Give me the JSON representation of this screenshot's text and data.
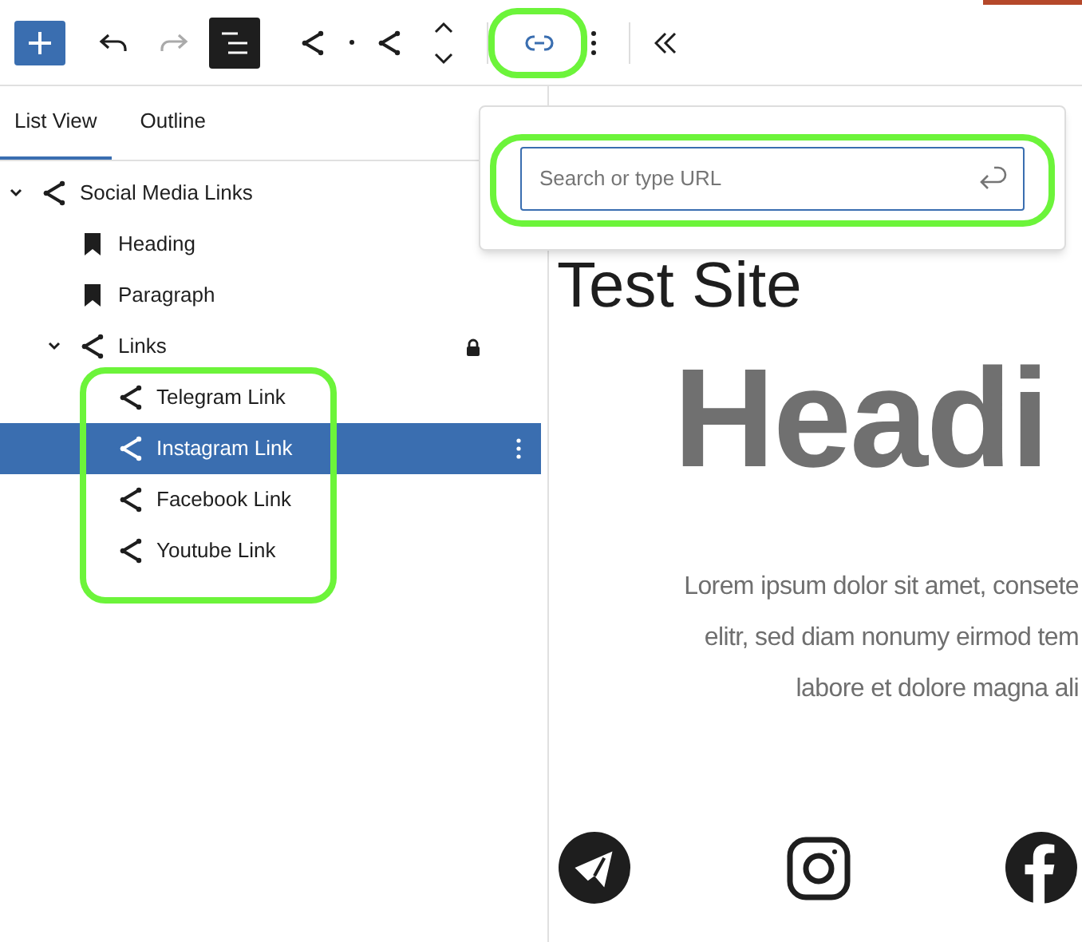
{
  "toolbar": [
    {
      "kind": "add",
      "disabled": false,
      "pressed": false
    },
    {
      "kind": "undo",
      "disabled": false,
      "pressed": false
    },
    {
      "kind": "redo",
      "disabled": true,
      "pressed": false
    },
    {
      "kind": "list_view",
      "disabled": false,
      "pressed": true
    },
    {
      "kind": "share",
      "disabled": false,
      "pressed": false
    },
    {
      "kind": "dot",
      "disabled": false,
      "pressed": false
    },
    {
      "kind": "share",
      "disabled": false,
      "pressed": false
    },
    {
      "kind": "move",
      "disabled": false,
      "pressed": false
    },
    {
      "kind": "link",
      "disabled": false,
      "pressed": false,
      "highlighted": true
    },
    {
      "kind": "more",
      "disabled": false,
      "pressed": false
    },
    {
      "kind": "collapse",
      "disabled": false,
      "pressed": false
    }
  ],
  "tabs": [
    {
      "label": "List View",
      "selected": true
    },
    {
      "label": "Outline",
      "selected": false
    }
  ],
  "tree": [
    {
      "label": "Social Media Links",
      "kind": "links",
      "expanded": true,
      "selected": false,
      "locked": false,
      "children": [
        {
          "label": "Heading",
          "kind": "text",
          "selected": false,
          "locked": false
        },
        {
          "label": "Paragraph",
          "kind": "text",
          "selected": false,
          "locked": false
        },
        {
          "label": "Links",
          "kind": "links",
          "expanded": true,
          "selected": false,
          "locked": true,
          "highlight_children": true,
          "children": [
            {
              "label": "Telegram Link",
              "kind": "links",
              "selected": false,
              "locked": false
            },
            {
              "label": "Instagram Link",
              "kind": "links",
              "selected": true,
              "locked": false
            },
            {
              "label": "Facebook Link",
              "kind": "links",
              "selected": false,
              "locked": false
            },
            {
              "label": "Youtube Link",
              "kind": "links",
              "selected": false,
              "locked": false
            }
          ]
        }
      ]
    }
  ],
  "link_popover": {
    "placeholder": "Search or type URL",
    "highlighted": true
  },
  "canvas": {
    "site_title": "Test Site",
    "heading": "Headi",
    "paragraph_lines": [
      "Lorem ipsum dolor sit amet, consete",
      "elitr, sed diam nonumy eirmod tem",
      "labore et dolore magna ali"
    ],
    "social_icons": [
      {
        "kind": "telegram"
      },
      {
        "kind": "instagram"
      },
      {
        "kind": "facebook"
      }
    ]
  }
}
